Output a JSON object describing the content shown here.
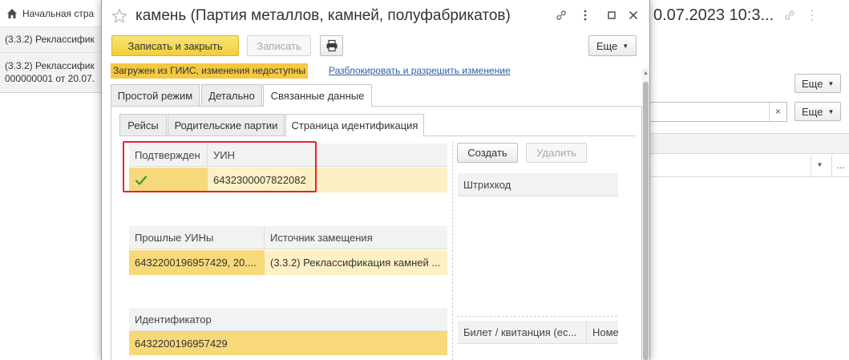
{
  "background": {
    "home_label": "Начальная стра",
    "list_item_1": "(3.3.2) Реклассифик",
    "list_item_2_line1": "(3.3.2) Реклассифик",
    "list_item_2_line2": "000000001 от 20.07.",
    "doc_title": "0.07.2023 10:3...",
    "still_label_1": "Еще",
    "still_label_2": "Еще",
    "search_clear": "×",
    "filter_more": "..."
  },
  "dialog": {
    "title": "камень (Партия металлов, камней, полуфабрикатов)",
    "toolbar": {
      "save_close_label": "Записать и закрыть",
      "save_label": "Записать",
      "more_label": "Еще"
    },
    "notice": "Загружен из ГИИС, изменения недоступны",
    "unlock_link": "Разблокировать и разрешить изменение",
    "tabs": [
      "Простой режим",
      "Детально",
      "Связанные данные"
    ],
    "active_tab": "Связанные данные",
    "subtabs": [
      "Рейсы",
      "Родительские партии",
      "Страница идентификация"
    ],
    "active_subtab": "Страница идентификация",
    "uin_table": {
      "columns": [
        "Подтвержден",
        "УИН"
      ],
      "rows": [
        {
          "confirmed": true,
          "uin": "6432300007822082"
        }
      ]
    },
    "past_table": {
      "columns": [
        "Прошлые УИНы",
        "Источник замещения"
      ],
      "rows": [
        {
          "past_uins": "6432200196957429, 20....",
          "source": "(3.3.2) Реклассификация камней ..."
        }
      ]
    },
    "identifier_table": {
      "columns": [
        "Идентификатор"
      ],
      "rows": [
        "6432200196957429"
      ]
    },
    "barcode": {
      "create_label": "Создать",
      "delete_label": "Удалить",
      "column": "Штрихкод"
    },
    "ticket_table": {
      "columns": [
        "Билет / квитанция (ес...",
        "Номе"
      ]
    }
  },
  "colors": {
    "primary_button": "#f5d449",
    "notice_bg": "#f5c842",
    "selected_row": "#fcf0c4",
    "highlight_border": "#e3242b",
    "link": "#2d5fa4",
    "check": "#2e9e3e"
  }
}
